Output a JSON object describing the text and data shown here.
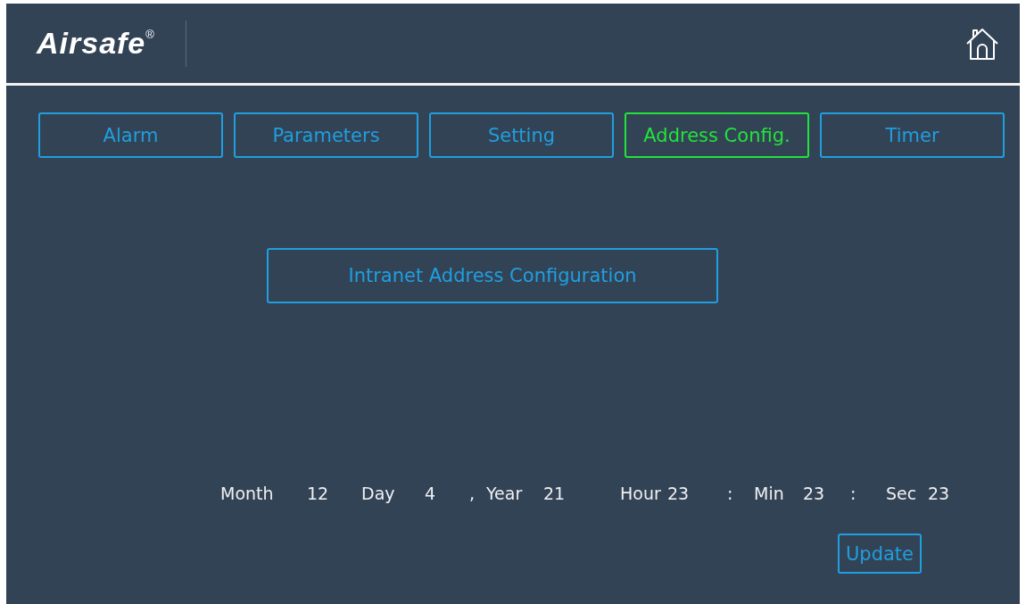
{
  "header": {
    "logo": "Airsafe$^{®}$"
  },
  "tabs": [
    {
      "label": "Alarm",
      "selected": false
    },
    {
      "label": "Parameters",
      "selected": false
    },
    {
      "label": "Setting",
      "selected": false
    },
    {
      "label": "Address Config.",
      "selected": true
    },
    {
      "label": "Timer",
      "selected": false
    }
  ],
  "config_button": "Intranet Address Configuration",
  "datetime": [
    "Month",
    "12",
    "Day",
    "4",
    ",",
    "Year",
    "21",
    "Hour",
    "23",
    ":",
    "Min",
    "23",
    ":",
    "Sec",
    "23"
  ],
  "update_button": "Update"
}
